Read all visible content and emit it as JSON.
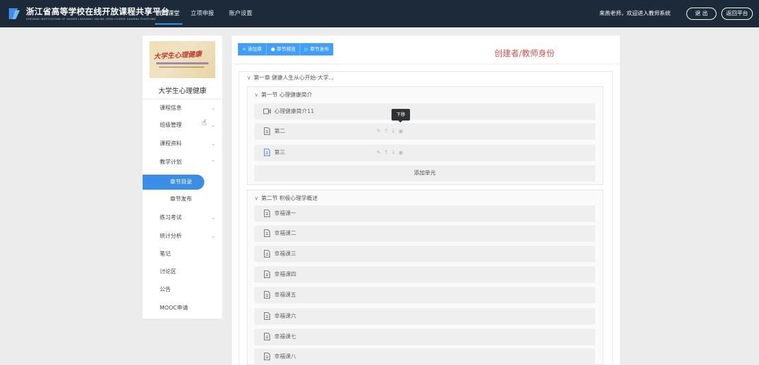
{
  "header": {
    "title": "浙江省高等学校在线开放课程共享平台",
    "subtitle": "ZHEJIANG INSTITUTIONS OF HIGHER LEARNING ONLINE OPEN COURSE SHARING PLATFORM",
    "nav": [
      "我的课堂",
      "立项申报",
      "账户设置"
    ],
    "welcome": "来燕老师，欢迎进入教师系统",
    "logout_label": "退 出",
    "return_label": "返回平台"
  },
  "sidebar": {
    "cover_text": "大学生心理健康",
    "course_name": "大学生心理健康",
    "menu": [
      {
        "label": "课程信息",
        "chevron": "⌄"
      },
      {
        "label": "班级管理",
        "chevron": "⌄"
      },
      {
        "label": "课程资料",
        "chevron": "⌄"
      },
      {
        "label": "教学计划",
        "chevron": "⌃"
      },
      {
        "label": "练习考试",
        "chevron": "⌄"
      },
      {
        "label": "统计分析",
        "chevron": "⌄"
      },
      {
        "label": "笔记",
        "chevron": ""
      },
      {
        "label": "讨论区",
        "chevron": ""
      },
      {
        "label": "公告",
        "chevron": ""
      },
      {
        "label": "MOOC申请",
        "chevron": ""
      }
    ],
    "submenu": {
      "active": "章节目录",
      "other": "章节发布"
    }
  },
  "toolbar": {
    "add_chapter": "+ 添加章",
    "preview": "章节预览",
    "publish": "章节发布"
  },
  "annotation": "创建者/教师身份",
  "chapter": {
    "title": "第一章 健康人生从心开始-大学...",
    "sections": [
      {
        "title": "第一节 心理健康简介",
        "units": [
          {
            "name": "心理健康简介11",
            "icon": "video-icon"
          },
          {
            "name": "第二",
            "icon": "document-icon"
          },
          {
            "name": "第三",
            "icon": "document-icon"
          }
        ],
        "add_unit": "添加单元",
        "tooltip": "下移"
      },
      {
        "title": "第二节 积极心理学概述",
        "units": [
          {
            "name": "幸福课一"
          },
          {
            "name": "幸福课二"
          },
          {
            "name": "幸福课三"
          },
          {
            "name": "幸福课四"
          },
          {
            "name": "幸福课五"
          },
          {
            "name": "幸福课六"
          },
          {
            "name": "幸福课七"
          },
          {
            "name": "幸福课八"
          }
        ]
      }
    ]
  },
  "unit_actions": [
    "✎",
    "↑",
    "↓",
    "◉"
  ],
  "colors": {
    "topbar": "#1d2a3a",
    "accent": "#409eff",
    "annotation": "#d9534f"
  }
}
